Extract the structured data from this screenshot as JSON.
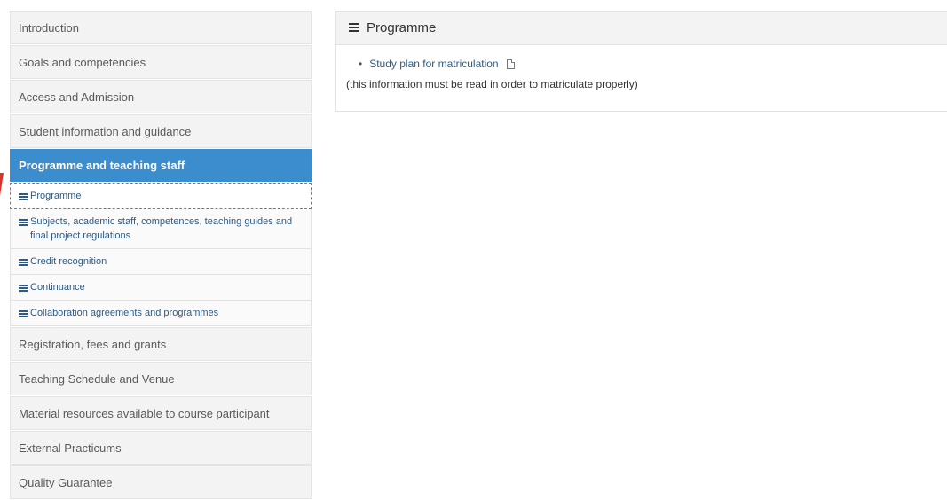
{
  "sidebar": {
    "items_top": [
      {
        "label": "Introduction"
      },
      {
        "label": "Goals and competencies"
      },
      {
        "label": "Access and Admission"
      },
      {
        "label": "Student information and guidance"
      }
    ],
    "active_section": {
      "label": "Programme and teaching staff"
    },
    "sub_items": [
      {
        "label": "Programme"
      },
      {
        "label": "Subjects, academic staff, competences, teaching guides and final project regulations"
      },
      {
        "label": "Credit recognition"
      },
      {
        "label": "Continuance"
      },
      {
        "label": "Collaboration agreements and programmes"
      }
    ],
    "items_bottom": [
      {
        "label": "Registration, fees and grants"
      },
      {
        "label": "Teaching Schedule and Venue"
      },
      {
        "label": "Material resources available to course participant"
      },
      {
        "label": "External Practicums"
      },
      {
        "label": "Quality Guarantee"
      }
    ]
  },
  "panel": {
    "title": "Programme",
    "link_label": "Study plan for matriculation",
    "note": "(this information must be read in order to matriculate properly)"
  },
  "colors": {
    "active_bg": "#3c8dcd",
    "link": "#2d5b84",
    "accent_mark": "#d9342b"
  }
}
